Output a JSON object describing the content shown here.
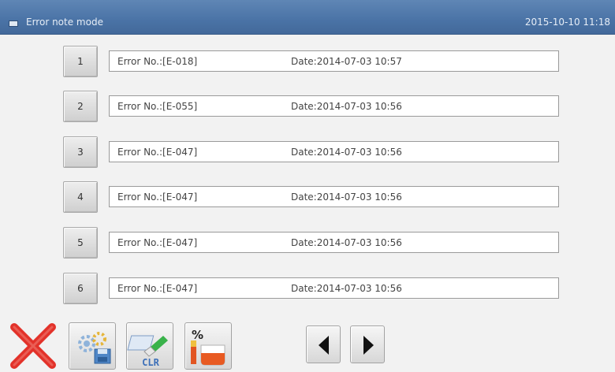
{
  "header": {
    "title": "Error note mode",
    "datetime": "2015-10-10 11:18"
  },
  "records": [
    {
      "index": "1",
      "error": "Error No.:[E-018]",
      "date": "Date:2014-07-03  10:57"
    },
    {
      "index": "2",
      "error": "Error No.:[E-055]",
      "date": "Date:2014-07-03  10:56"
    },
    {
      "index": "3",
      "error": "Error No.:[E-047]",
      "date": "Date:2014-07-03  10:56"
    },
    {
      "index": "4",
      "error": "Error No.:[E-047]",
      "date": "Date:2014-07-03  10:56"
    },
    {
      "index": "5",
      "error": "Error No.:[E-047]",
      "date": "Date:2014-07-03  10:56"
    },
    {
      "index": "6",
      "error": "Error No.:[E-047]",
      "date": "Date:2014-07-03  10:56"
    }
  ],
  "toolbar": {
    "cancel_icon": "close-x-icon",
    "settings_icon": "settings-disk-icon",
    "clear_label": "CLR",
    "counter_label": "%",
    "prev_icon": "arrow-left-icon",
    "next_icon": "arrow-right-icon"
  },
  "colors": {
    "titlebar": "#4a73a6",
    "close_red": "#e2322a",
    "background": "#f2f2f2"
  }
}
